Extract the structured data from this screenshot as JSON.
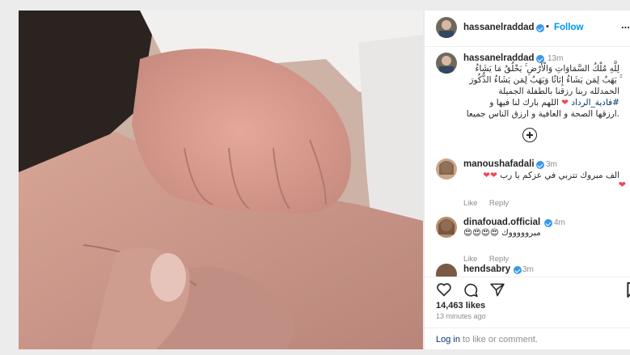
{
  "post": {
    "author": "hassanelraddad",
    "follow_label": "Follow",
    "separator": "•",
    "more": "..."
  },
  "caption": {
    "author": "hassanelraddad",
    "time": "13m",
    "line1": "لِلَّهِ مُلْكُ السَّمَاوَاتِ وَالْأَرْضِ ۚ يَخْلُقُ مَا يَشَاءُ",
    "line2": "ۚ يَهَبُ لِمَن يَشَاءُ إِنَاثًا وَيَهَبُ لِمَن يَشَاءُ الذُّكُورَ",
    "line3": "الحمدلله ربنا رزقنا بالطفلة الجميلة",
    "line4_tag": "#فادية_الرداد",
    "line4_text": "اللهم بارك لنا فيها و",
    "line5": ".ارزقها الصحة و العافية و ارزق الناس جميعا"
  },
  "comments": [
    {
      "author": "manoushafadali",
      "time": "3m",
      "text": "الف مبروك تتربي في عزكم يا رب",
      "like": "Like",
      "reply": "Reply"
    },
    {
      "author": "dinafouad.official",
      "time": "4m",
      "text": "مبروووووك",
      "emojis": "😍😍😍😍",
      "like": "Like",
      "reply": "Reply"
    },
    {
      "author": "hendsabry",
      "time": "3m"
    }
  ],
  "stats": {
    "likes": "14,463 likes",
    "time_ago": "13 minutes ago"
  },
  "footer": {
    "login_link": "Log in",
    "login_rest": "to like or comment."
  },
  "colors": {
    "link_blue": "#0095f6",
    "verified": "#3897f0",
    "heart_red": "#ed4956"
  }
}
